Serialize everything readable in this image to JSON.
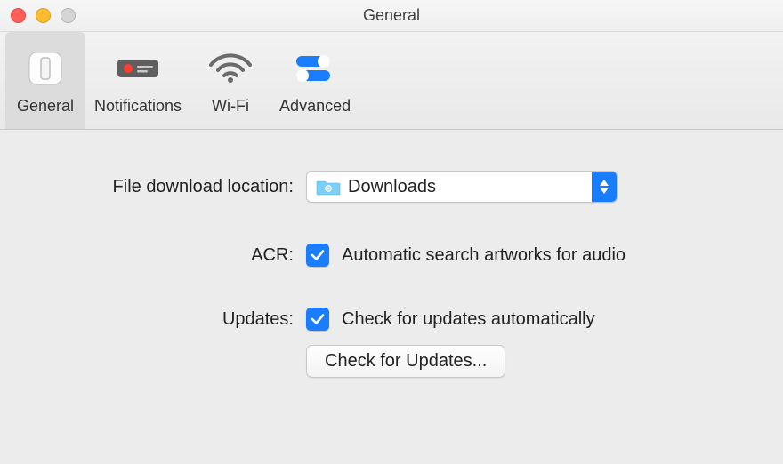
{
  "window": {
    "title": "General"
  },
  "tabs": {
    "general": "General",
    "notifications": "Notifications",
    "wifi": "Wi-Fi",
    "advanced": "Advanced"
  },
  "settings": {
    "download_label": "File download location:",
    "download_value": "Downloads",
    "acr_label": "ACR:",
    "acr_option": "Automatic search artworks for audio",
    "updates_label": "Updates:",
    "updates_option": "Check for updates automatically",
    "check_updates_btn": "Check for Updates..."
  }
}
